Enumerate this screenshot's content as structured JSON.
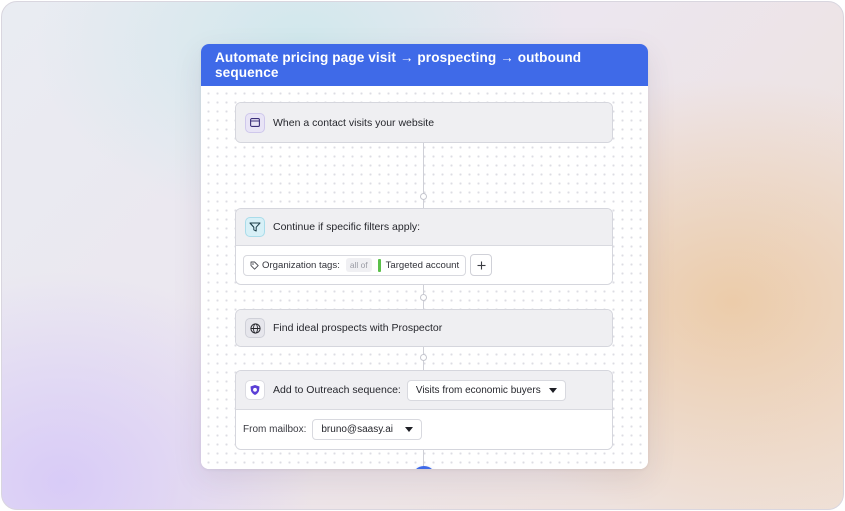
{
  "workflow": {
    "title": "Automate pricing page visit → prospecting → outbound sequence"
  },
  "steps": {
    "trigger": {
      "label": "When a contact visits your website",
      "icon": "browser-window-icon"
    },
    "filter": {
      "label": "Continue if specific filters apply:",
      "icon": "filter-funnel-icon",
      "tag_label": "Organization tags:",
      "match_mode": "all of",
      "tag_value": "Targeted account",
      "tag_color": "#5bc04a"
    },
    "prospector": {
      "label": "Find ideal prospects with Prospector",
      "icon": "globe-icon"
    },
    "outreach": {
      "label": "Add to Outreach sequence:",
      "icon": "outreach-logo-icon",
      "sequence_value": "Visits from economic buyers",
      "mailbox_label": "From mailbox:",
      "mailbox_value": "bruno@saasy.ai"
    }
  },
  "add_step": {
    "icon": "plus-icon"
  },
  "colors": {
    "accent": "#3f6ae8",
    "tag_green": "#5bc04a",
    "outreach_purple": "#5b3fd6"
  }
}
